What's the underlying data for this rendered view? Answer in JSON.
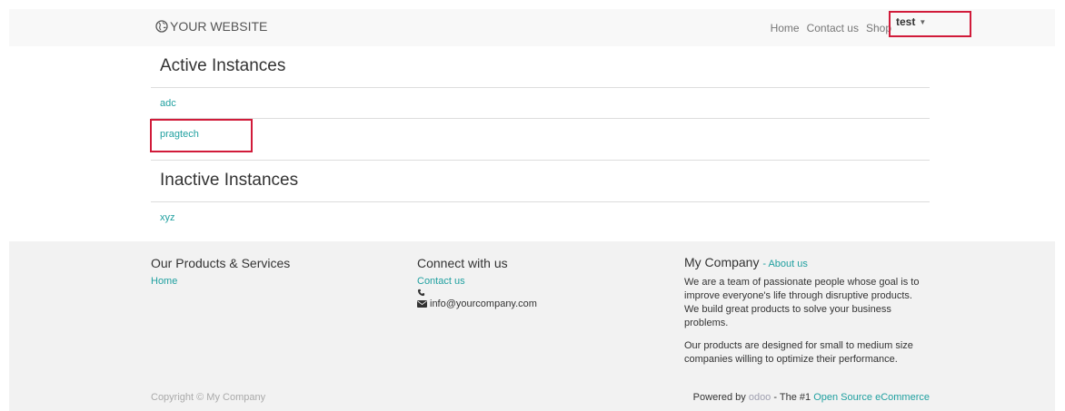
{
  "navbar": {
    "brand": "YOUR WEBSITE",
    "links": [
      "Home",
      "Contact us",
      "Shop"
    ],
    "user": "test"
  },
  "main": {
    "active_title": "Active Instances",
    "active_instances": [
      "adc",
      "pragtech"
    ],
    "inactive_title": "Inactive Instances",
    "inactive_instances": [
      "xyz"
    ]
  },
  "footer": {
    "products_title": "Our Products & Services",
    "products_links": [
      "Home"
    ],
    "connect_title": "Connect with us",
    "contact_link": "Contact us",
    "email": "info@yourcompany.com",
    "company_name": "My Company",
    "about_link": "- About us",
    "about_text_1": "We are a team of passionate people whose goal is to improve everyone's life through disruptive products. We build great products to solve your business problems.",
    "about_text_2": "Our products are designed for small to medium size companies willing to optimize their performance.",
    "copyright": "Copyright © My Company",
    "powered_by": "Powered by",
    "odoo_logo_text": "odoo",
    "tagline": "- The #1",
    "tagline_link": "Open Source eCommerce"
  },
  "colors": {
    "link": "#20a0a0",
    "highlight_box": "#d11b3a",
    "navbar_bg": "#f8f8f8",
    "footer_bg": "#f2f2f2"
  },
  "icons": [
    "globe-icon",
    "caret-down-icon",
    "phone-icon",
    "envelope-icon"
  ]
}
